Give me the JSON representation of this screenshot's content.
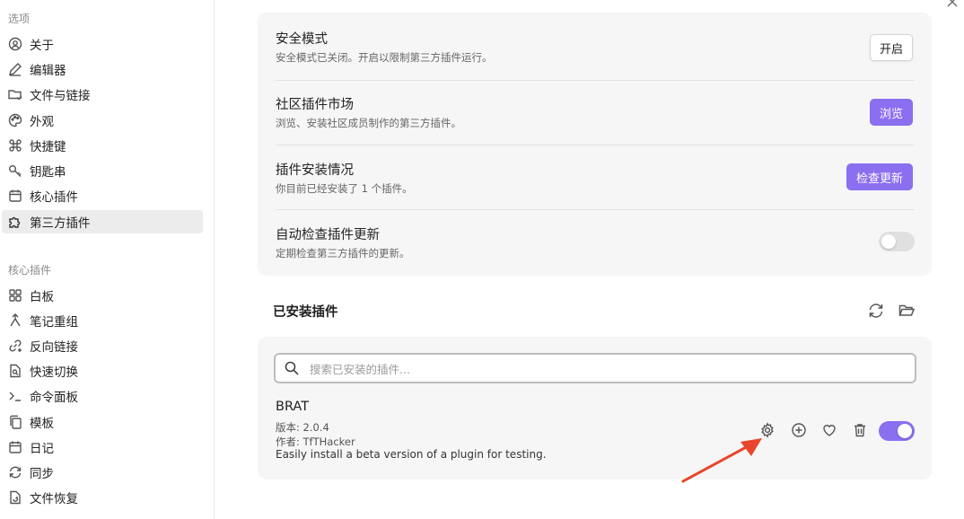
{
  "sidebar": {
    "options_title": "选项",
    "options": [
      {
        "label": "关于",
        "icon": "info-circle-icon"
      },
      {
        "label": "编辑器",
        "icon": "pencil-icon"
      },
      {
        "label": "文件与链接",
        "icon": "folder-link-icon"
      },
      {
        "label": "外观",
        "icon": "palette-icon"
      },
      {
        "label": "快捷键",
        "icon": "command-icon"
      },
      {
        "label": "钥匙串",
        "icon": "key-icon"
      },
      {
        "label": "核心插件",
        "icon": "calendar-box-icon"
      },
      {
        "label": "第三方插件",
        "icon": "puzzle-icon",
        "active": true
      }
    ],
    "core_title": "核心插件",
    "core_plugins": [
      {
        "label": "白板",
        "icon": "canvas-grid-icon"
      },
      {
        "label": "笔记重组",
        "icon": "merge-icon"
      },
      {
        "label": "反向链接",
        "icon": "backlink-icon"
      },
      {
        "label": "快速切换",
        "icon": "file-search-icon"
      },
      {
        "label": "命令面板",
        "icon": "terminal-icon"
      },
      {
        "label": "模板",
        "icon": "copy-files-icon"
      },
      {
        "label": "日记",
        "icon": "calendar-icon"
      },
      {
        "label": "同步",
        "icon": "sync-icon"
      },
      {
        "label": "文件恢复",
        "icon": "file-restore-icon"
      }
    ]
  },
  "settings": {
    "safe_mode": {
      "title": "安全模式",
      "desc": "安全模式已关闭。开启以限制第三方插件运行。",
      "button": "开启"
    },
    "community": {
      "title": "社区插件市场",
      "desc": "浏览、安装社区成员制作的第三方插件。",
      "button": "浏览"
    },
    "installed_status": {
      "title": "插件安装情况",
      "desc": "你目前已经安装了 1 个插件。",
      "button": "检查更新"
    },
    "auto_check": {
      "title": "自动检查插件更新",
      "desc": "定期检查第三方插件的更新。",
      "toggle_on": false
    }
  },
  "installed": {
    "heading": "已安装插件",
    "reload_icon": "refresh-icon",
    "folder_icon": "folder-open-icon",
    "search_placeholder": "搜索已安装的插件...",
    "plugins": [
      {
        "name": "BRAT",
        "version": "版本: 2.0.4",
        "author": "作者: TfTHacker",
        "description": "Easily install a beta version of a plugin for testing.",
        "enabled": true,
        "actions": [
          "gear-icon",
          "plus-circle-icon",
          "heart-icon",
          "trash-icon"
        ]
      }
    ]
  },
  "colors": {
    "accent": "#8a6ff0",
    "annotation_arrow": "#e8452c"
  }
}
